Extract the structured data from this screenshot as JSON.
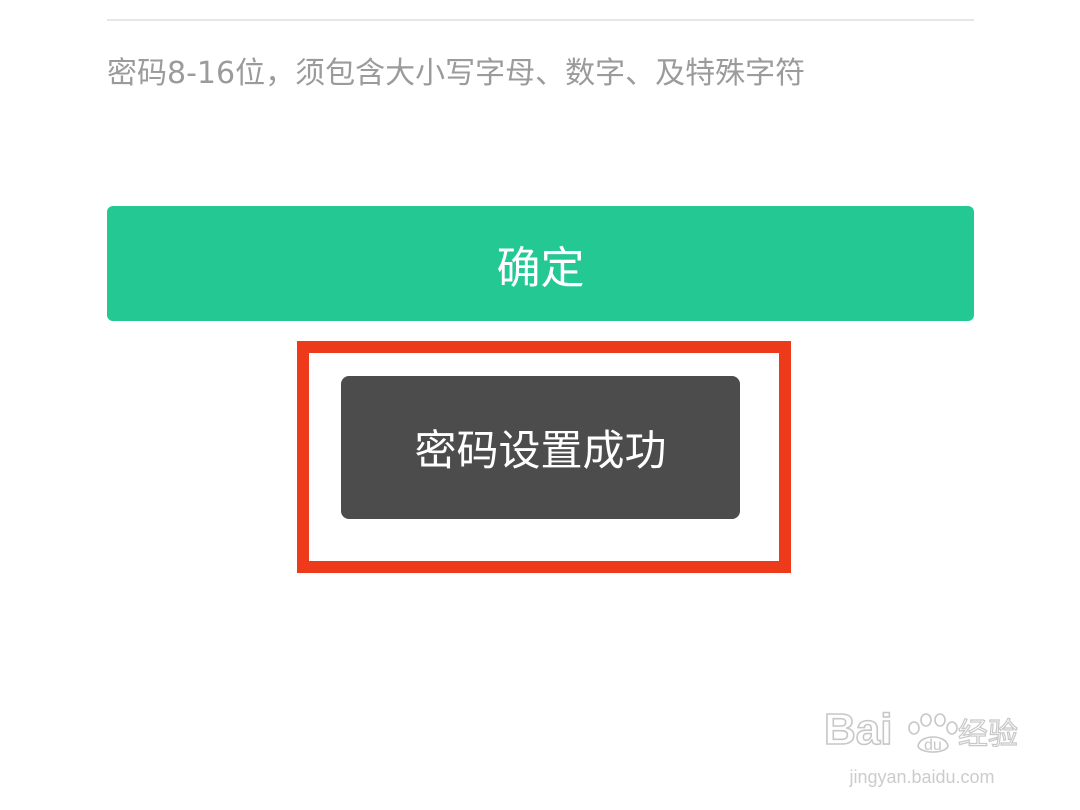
{
  "form": {
    "password_hint": "密码8-16位，须包含大小写字母、数字、及特殊字符",
    "confirm_label": "确定"
  },
  "toast": {
    "message": "密码设置成功"
  },
  "watermark": {
    "brand": "Baidu经验",
    "url": "jingyan.baidu.com"
  },
  "colors": {
    "accent_green": "#24c893",
    "toast_bg": "#4c4c4c",
    "highlight_red": "#ec3a1a",
    "hint_text": "#9b9b9b"
  }
}
